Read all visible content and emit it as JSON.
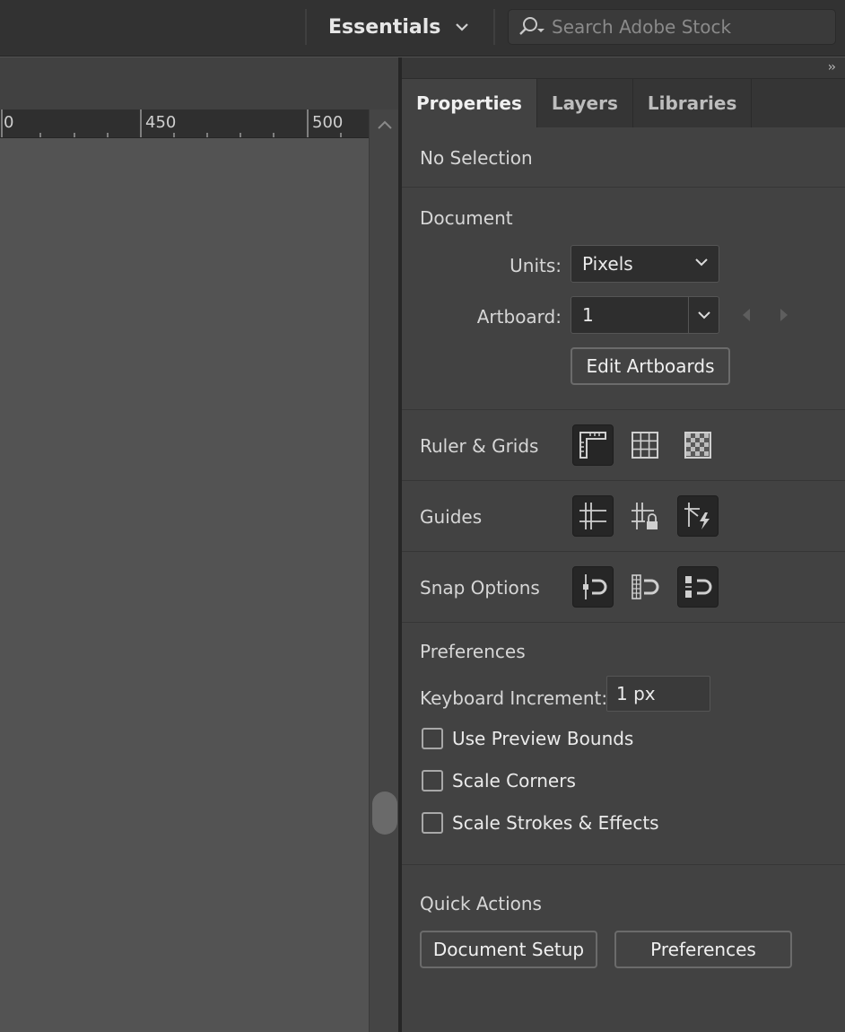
{
  "topbar": {
    "workspace_label": "Essentials",
    "stock_search_placeholder": "Search Adobe Stock"
  },
  "ruler": {
    "labels": [
      "0",
      "450",
      "500"
    ]
  },
  "panel": {
    "tabs": [
      {
        "label": "Properties",
        "active": true
      },
      {
        "label": "Layers",
        "active": false
      },
      {
        "label": "Libraries",
        "active": false
      }
    ],
    "selection_status": "No Selection",
    "document": {
      "title": "Document",
      "units_label": "Units:",
      "units_value": "Pixels",
      "artboard_label": "Artboard:",
      "artboard_value": "1",
      "edit_artboards_button": "Edit Artboards"
    },
    "ruler_grids": {
      "title": "Ruler & Grids",
      "icons": [
        "ruler-icon",
        "grid-icon",
        "transparency-grid-icon"
      ]
    },
    "guides": {
      "title": "Guides",
      "icons": [
        "guides-icon",
        "lock-guides-icon",
        "smart-guides-icon"
      ]
    },
    "snap_options": {
      "title": "Snap Options",
      "icons": [
        "snap-to-point-icon",
        "snap-to-pixel-icon",
        "snap-to-glyph-icon"
      ]
    },
    "preferences": {
      "title": "Preferences",
      "keyboard_increment_label": "Keyboard Increment:",
      "keyboard_increment_value": "1 px",
      "checkboxes": [
        {
          "label": "Use Preview Bounds",
          "checked": false
        },
        {
          "label": "Scale Corners",
          "checked": false
        },
        {
          "label": "Scale Strokes & Effects",
          "checked": false
        }
      ]
    },
    "quick_actions": {
      "title": "Quick Actions",
      "document_setup_button": "Document Setup",
      "preferences_button": "Preferences"
    }
  },
  "colors": {
    "panel_bg": "#424242",
    "canvas_bg": "#535353",
    "topbar_bg": "#323232"
  }
}
